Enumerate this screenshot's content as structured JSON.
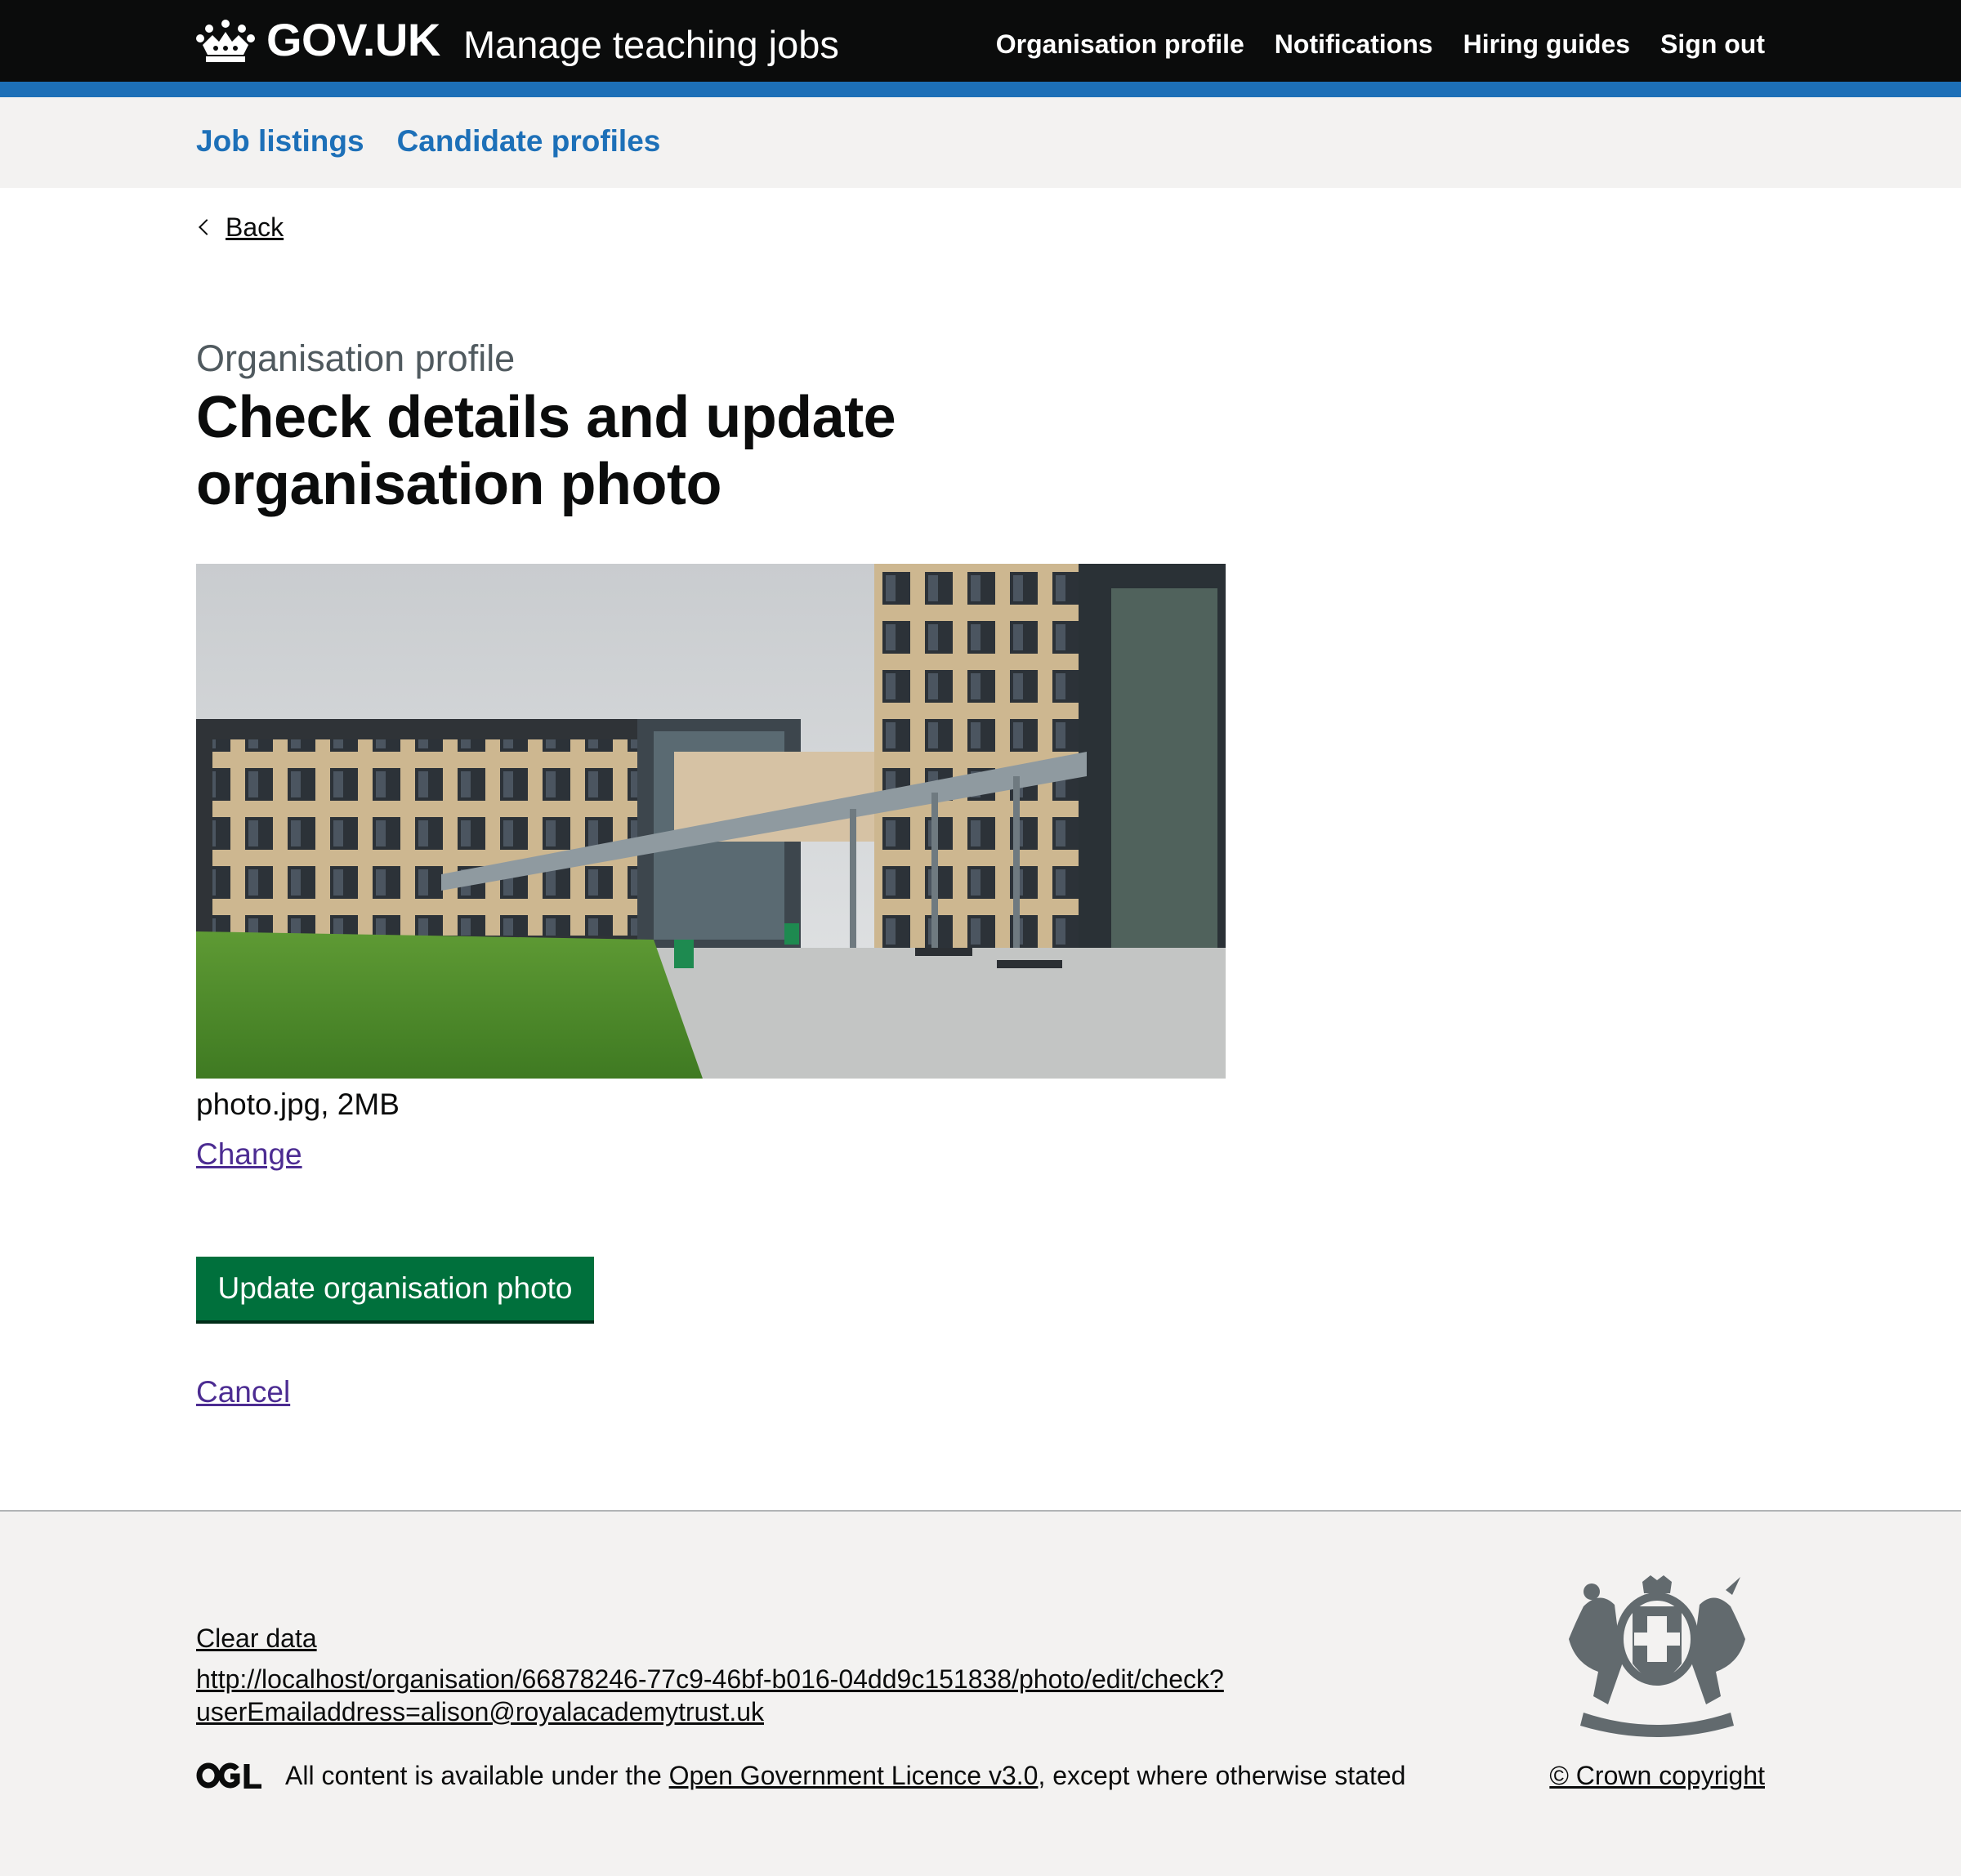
{
  "header": {
    "logo_text": "GOV.UK",
    "service_name": "Manage teaching jobs",
    "nav": [
      "Organisation profile",
      "Notifications",
      "Hiring guides",
      "Sign out"
    ]
  },
  "subnav": {
    "items": [
      "Job listings",
      "Candidate profiles"
    ]
  },
  "back_label": "Back",
  "page": {
    "caption": "Organisation profile",
    "title": "Check details and update organisation photo",
    "photo_file": "photo.jpg, 2MB",
    "change_label": "Change",
    "submit_label": "Update organisation photo",
    "cancel_label": "Cancel"
  },
  "footer": {
    "clear_data": "Clear data",
    "url_line1": "http://localhost/organisation/66878246-77c9-46bf-b016-04dd9c151838/photo/edit/check?",
    "url_line2": "userEmailaddress=alison@royalacademytrust.uk",
    "licence_prefix": "All content is available under the ",
    "licence_link": "Open Government Licence v3.0",
    "licence_suffix": ", except where otherwise stated",
    "copyright": "© Crown copyright"
  },
  "colors": {
    "header_bg": "#0b0c0c",
    "brand_blue": "#1d70b8",
    "button_green": "#00703c",
    "link_visited": "#4c2c92",
    "footer_bg": "#f3f2f1"
  }
}
